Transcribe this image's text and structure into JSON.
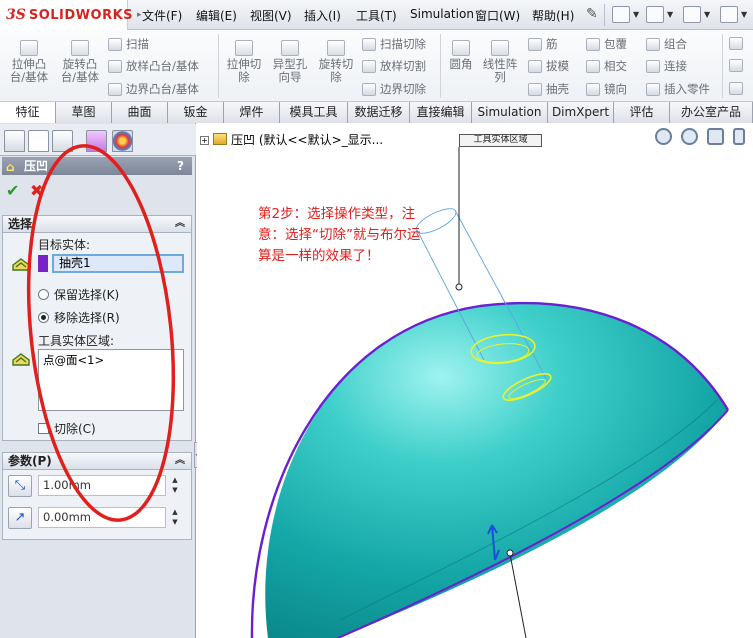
{
  "app": {
    "logo_mark": "3S",
    "logo_text": "SOLIDWORKS"
  },
  "menu": [
    "文件(F)",
    "编辑(E)",
    "视图(V)",
    "插入(I)",
    "工具(T)",
    "Simulation",
    "窗口(W)",
    "帮助(H)"
  ],
  "commands": {
    "extrude_boss": "拉伸凸\n台/基体",
    "revolve_boss": "旋转凸\n台/基体",
    "sweep": "扫描",
    "loft_boss": "放样凸台/基体",
    "boundary_boss": "边界凸台/基体",
    "extrude_cut": "拉伸切\n除",
    "hole_wizard": "异型孔\n向导",
    "revolve_cut": "旋转切\n除",
    "swept_cut": "扫描切除",
    "lofted_cut": "放样切割",
    "boundary_cut": "边界切除",
    "fillet": "圆角",
    "linear_pattern": "线性阵\n列",
    "rib": "筋",
    "draft": "拔模",
    "shell": "抽壳",
    "wrap": "包覆",
    "intersect": "相交",
    "mirror": "镜向",
    "combine": "组合",
    "join": "连接",
    "insert_part": "插入零件"
  },
  "tabs": [
    "特征",
    "草图",
    "曲面",
    "钣金",
    "焊件",
    "模具工具",
    "数据迁移",
    "直接编辑",
    "Simulation",
    "DimXpert",
    "评估",
    "办公室产品"
  ],
  "active_tab": "特征",
  "property_manager": {
    "title": "压凹",
    "help": "?",
    "selection": {
      "header": "选择",
      "target_label": "目标实体:",
      "target_value": "抽壳1",
      "keep": "保留选择(K)",
      "remove": "移除选择(R)",
      "selected_option": "remove",
      "tool_label": "工具实体区域:",
      "tool_value": "点@面<1>",
      "cut_label": "切除(C)",
      "cut_checked": false
    },
    "parameters": {
      "header": "参数(P)",
      "thickness": "1.00mm",
      "clearance": "0.00mm"
    }
  },
  "graphics": {
    "tree_text": "压凹 (默认<<默认>_显示...",
    "tool_tag": "工具实体区域",
    "annotation": "第2步：选择操作类型，注意：选择“切除”就与布尔运算是一样的效果了！",
    "dome_color": "#13a3a3",
    "edge_color": "#6a1fd0",
    "annotation_color": "#e0201c"
  }
}
